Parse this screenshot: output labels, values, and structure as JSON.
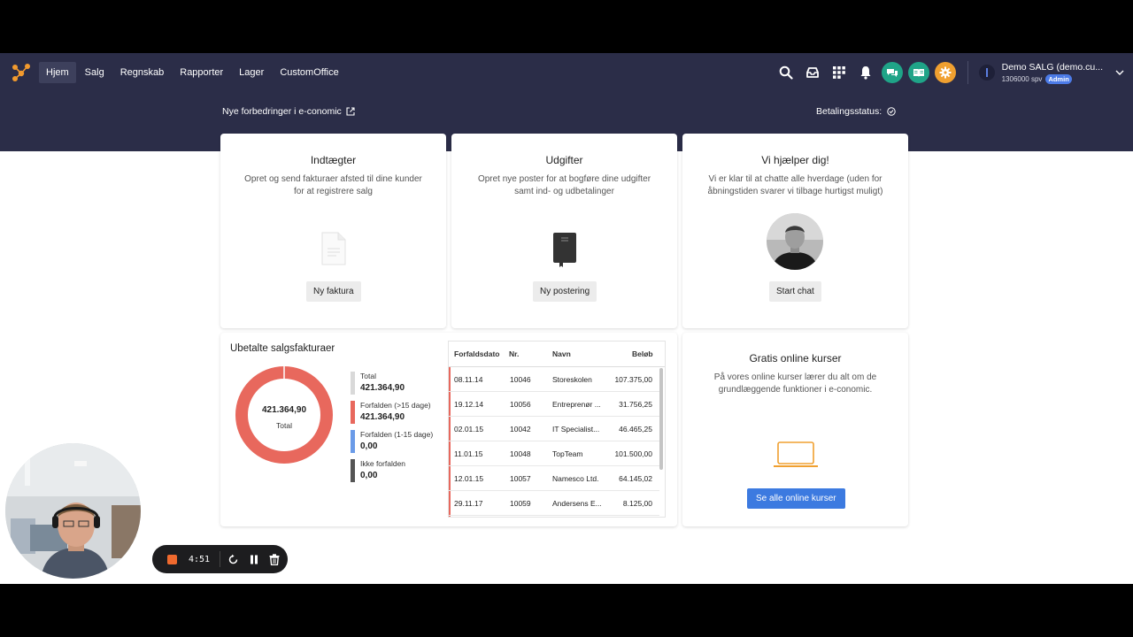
{
  "nav": {
    "items": [
      "Hjem",
      "Salg",
      "Regnskab",
      "Rapporter",
      "Lager",
      "CustomOffice"
    ],
    "active": "Hjem"
  },
  "user": {
    "name": "Demo SALG (demo.cu...",
    "sub": "1306000 spv",
    "badge": "Admin"
  },
  "subbar": {
    "left": "Nye forbedringer i e-conomic",
    "right": "Betalingsstatus:"
  },
  "cards": {
    "income": {
      "title": "Indtægter",
      "desc1": "Opret og send fakturaer afsted til dine kunder",
      "desc2": "for at registrere salg",
      "button": "Ny faktura"
    },
    "expenses": {
      "title": "Udgifter",
      "desc1": "Opret nye poster for at bogføre dine udgifter",
      "desc2": "samt ind- og udbetalinger",
      "button": "Ny postering"
    },
    "help": {
      "title": "Vi hjælper dig!",
      "desc1": "Vi er klar til at chatte alle hverdage (uden for",
      "desc2": "åbningstiden svarer vi tilbage hurtigst muligt)",
      "button": "Start chat"
    },
    "courses": {
      "title": "Gratis online kurser",
      "desc1": "På vores online kurser lærer du alt om de",
      "desc2": "grundlæggende funktioner i e-conomic.",
      "button": "Se alle online kurser"
    }
  },
  "unpaid": {
    "title": "Ubetalte salgsfakturaer",
    "donut_value": "421.364,90",
    "donut_label": "Total",
    "legend": [
      {
        "label": "Total",
        "value": "421.364,90",
        "color": "#d9d9d9"
      },
      {
        "label": "Forfalden (>15 dage)",
        "value": "421.364,90",
        "color": "#e8685d"
      },
      {
        "label": "Forfalden (1-15 dage)",
        "value": "0,00",
        "color": "#6b9be8"
      },
      {
        "label": "Ikke forfalden",
        "value": "0,00",
        "color": "#555555"
      }
    ]
  },
  "table": {
    "headers": [
      "Forfaldsdato",
      "Nr.",
      "Navn",
      "Beløb"
    ],
    "rows": [
      [
        "08.11.14",
        "10046",
        "Storeskolen",
        "107.375,00"
      ],
      [
        "19.12.14",
        "10056",
        "Entreprenør ...",
        "31.756,25"
      ],
      [
        "02.01.15",
        "10042",
        "IT Specialist...",
        "46.465,25"
      ],
      [
        "11.01.15",
        "10048",
        "TopTeam",
        "101.500,00"
      ],
      [
        "12.01.15",
        "10057",
        "Namesco Ltd.",
        "64.145,02"
      ],
      [
        "29.11.17",
        "10059",
        "Andersens E...",
        "8.125,00"
      ]
    ]
  },
  "recorder": {
    "time": "4:51"
  },
  "colors": {
    "navy": "#2b2d48",
    "accent_blue": "#3c7ae0",
    "overdue_red": "#e8685d",
    "chat_green": "#1fa488",
    "gear_orange": "#f0a030"
  }
}
